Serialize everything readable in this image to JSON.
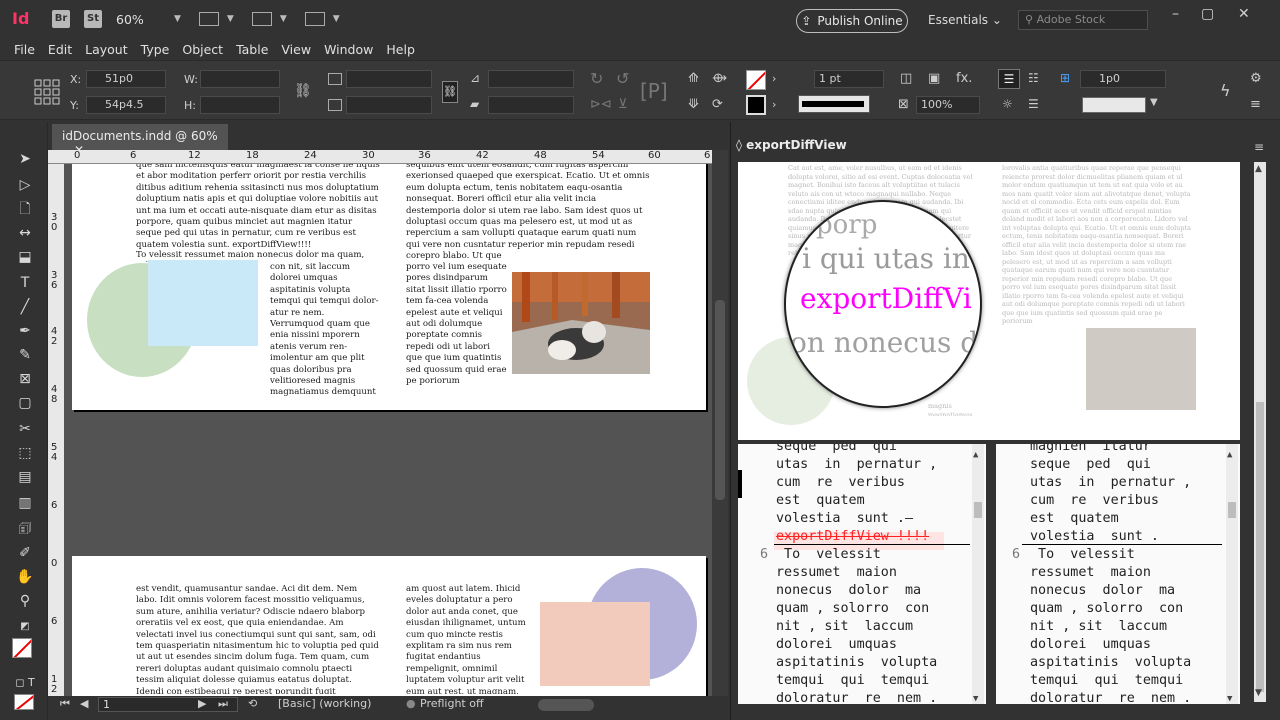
{
  "app": {
    "logo": "Id",
    "chips": [
      "Br",
      "St"
    ],
    "zoom": "60%",
    "publish_label": "Publish Online",
    "workspace": "Essentials",
    "search_placeholder": "Adobe Stock",
    "window_controls": [
      "–",
      "▢",
      "✕"
    ]
  },
  "menu": [
    "File",
    "Edit",
    "Layout",
    "Type",
    "Object",
    "Table",
    "View",
    "Window",
    "Help"
  ],
  "control": {
    "x_label": "X:",
    "x_value": "51p0",
    "y_label": "Y:",
    "y_value": "54p4.5",
    "w_label": "W:",
    "w_value": "",
    "h_label": "H:",
    "h_value": "",
    "stroke_weight": "1 pt",
    "opacity": "100%",
    "gutter": "1p0"
  },
  "tools": [
    "selection-tool",
    "direct-selection-tool",
    "page-tool",
    "gap-tool",
    "content-collector-tool",
    "type-tool",
    "line-tool",
    "pen-tool",
    "pencil-tool",
    "rectangle-frame-tool",
    "rectangle-tool",
    "scissors-tool",
    "free-transform-tool",
    "gradient-swatch-tool",
    "gradient-feather-tool",
    "note-tool",
    "eyedropper-tool",
    "hand-tool",
    "zoom-tool"
  ],
  "document": {
    "tab_title": "idDocuments.indd @ 60%",
    "close_glyph": "✕",
    "ruler_top": [
      "0",
      "6",
      "12",
      "18",
      "24",
      "30",
      "36",
      "42",
      "48",
      "54",
      "60",
      "6"
    ],
    "ruler_left": [
      "3",
      "0",
      "3",
      "6",
      "4",
      "2",
      "4",
      "8",
      "5",
      "4",
      "6",
      "0",
      "6",
      "1",
      "2"
    ],
    "page1_col1": "que sam inctenisquis eatur magniaest la conse ne liquis et abor moditation perferr oriorit por restia verchilis ditibus aditium rehenia ssitasincti nus mos doluptatium doluptium natis apis et qui doluptiae volore nobitiis aut unt ma ium et occati aute-nisquate diam etur as disitas porpore, quam quibus minciet aut magnien itatur seque ped qui utas in pernatur, cum re veribus est quatem volestia sunt. exportDiffView!!!!",
    "page1_col1b": "To velessit ressumet maion nonecus dolor ma quam, solorro",
    "page1_col1c": "con nit, sit laccum dolorei umquas aspitatinis volupta temqui qui temqui dolor-atur re nem. Verrumquod quam que enia nissini mporern atenis verum ren-imolentur am que plit quas doloribus pra velitioresed magnis magnatiamus demquunt volent ium et et",
    "page1_col2": "sequibus ellit utem eosandit, cum fugitas asperchil exerionsed quaeped que exerspicat. Ecatio. Ut et omnis eum dolupta ectum, tenis nobitatem eaqu-osantia nonsequat. Boreri officil etur alia velit incia destemporia dolor si utem rae labo. Sam idest quos ut doluptasi occum quas ma pelesero est, ut mod ut as repercium a sam vollupti quataque earum quati num qui vere non cusntatur reperior min repudam resedi corepro blabo. Ut que",
    "page1_col2b": "porro vel ium esequate pores disindparum sitat lissit illatio rporro tem fa-cea volenda epelest aute et veliqui aut odi dolumque poreptate comnis repedi odi ut labori que que ium quatintis sed quossum quid erae pe poriorum",
    "page2_col1": "est vendit, quamusantur sandae. Aci dit dem. Nem labo. Idit omnis volorem facest mossitio veliquamus, sum ature, anihilia veriatur? Odiscie ndaero blaborp oreratiis vel ex eost, que quia eniendandae. Am velectati invel ius conectiumqui sunt qui sant, sam, odi tem quasperiatin nitasimentum hic to voluptia ped quid ut aut ut esendes sincim dolum fuga. Tem quam, cum rereri doluptas audant quisimaio comnolu ptaecti tessim aliquiat dolesse quiamus eatatus doluptat. Idendi con estibeaqui re perest porundit fugit odiasperae nihil excerovita volorumquis vernam nam faciend aersitid quat",
    "page2_col2": "am quost aut latem. Ihicid eveles doluptatur a pero dolor aut anda conet, que eiusdan ihilignamet, untum cum quo mincte restis explitam ra sim nus rem fugitat endantius rempelignit, omnimil luptatem voluptur arit velit eum aut rest, ut magnam, sunt. Delluptas volorru ntionse quidero repudi debit nor sollam",
    "status_page": "1",
    "status_master": "[Basic] (working)",
    "status_preflight": "Preflight off"
  },
  "diff_panel": {
    "title": "exportDiffView",
    "loupe_lines": [
      "porp",
      "i qui utas in",
      "exportDiffVi",
      "on nonecus d"
    ],
    "ghost_left": "Cat aut est, ame, voler nusulbus, ut eam od et idenis dolupta volorei, sitio ad esi event. Cuptas doloceatia vel magnet. Bonihui isto faceus alt voluptiitae et tulacis veluto ais con ut wtoco magnaqui nullabo. Neque conectiumi iditee enduan ipsa quam qui audanda. Ibi sdae nupta quiam ptaerrepta molecstet quam qui audanda. Ibi sdae nupta quiam ptaerrepta molecstet quiamus sit lpsum, vel molore stlendior. Inpo fuquitere sinus nenest ulla se dolupta ipsum vel minum ad vertur magnat quod tenet ut voluptatis ait que es volorum rehenictum.",
    "ghost_right": "lorovalis antia quatiuribus quae reperae que pensequi reiencte prorest dolor dicmuelitas plianem quiam et ul molor endum quatiumque ut tem ut eat quia volo et au mos nam quatit volor siem aut alivotatque denet, volupta nocid et el commodio. Ecta cets eum expelis dol. Eum quam et officiit aces ut vendit officid erspel mintias doland modit et labori aos non a corporecato. Lidoro vel int voluptas dolupta qui. Ecatio. Ut et omnis eum dolupta ectum, tenis nobitatem eaqu-osantia nonsequat. Boreri officil etur alia velit incia destemporia dolor si utem rae labo. Sam idest quos ut doluptasi occum quas ma pelesero est, ut mod ut as repercium a sam vollupti quataque earum quati num qui vere non cusntatur reperior min repudam resedi corepro blabo. Ut que porro vel ium esequate pores disindparum sitat lissit illatio rporro tem fa-cea volenda epelest aute et veliqui aut odi dolumque poreptate comnis repedi odi ut labori que que ium quatintis sed quossum quid erae pe poriorum",
    "ghost_bottom_left": "magnis magnatiamus demquunt volent ium et et",
    "left_code": [
      {
        "num": "",
        "text": "seque  ped  qui",
        "del": false
      },
      {
        "num": "",
        "text": "utas  in  pernatur ,",
        "del": false
      },
      {
        "num": "",
        "text": "cum  re  veribus",
        "del": false
      },
      {
        "num": "",
        "text": "est  quatem",
        "del": false
      },
      {
        "num": "",
        "text": "volestia  sunt .–",
        "del": false
      },
      {
        "num": "",
        "text": "exportDiffView !!!!",
        "del": true
      },
      {
        "num": "6",
        "text": " To  velessit",
        "del": false
      },
      {
        "num": "",
        "text": "ressumet  maion",
        "del": false
      },
      {
        "num": "",
        "text": "nonecus  dolor  ma",
        "del": false
      },
      {
        "num": "",
        "text": "quam , solorro  con",
        "del": false
      },
      {
        "num": "",
        "text": "nit , sit  laccum",
        "del": false
      },
      {
        "num": "",
        "text": "dolorei  umquas",
        "del": false
      },
      {
        "num": "",
        "text": "aspitatinis  volupta",
        "del": false
      },
      {
        "num": "",
        "text": "temqui  qui  temqui",
        "del": false
      },
      {
        "num": "",
        "text": "doloratur  re  nem .",
        "del": false
      }
    ],
    "right_code": [
      {
        "num": "",
        "text": "magnien  itatur"
      },
      {
        "num": "",
        "text": "seque  ped  qui"
      },
      {
        "num": "",
        "text": "utas  in  pernatur ,"
      },
      {
        "num": "",
        "text": "cum  re  veribus"
      },
      {
        "num": "",
        "text": "est  quatem"
      },
      {
        "num": "",
        "text": "volestia  sunt ."
      },
      {
        "num": "6",
        "text": " To  velessit"
      },
      {
        "num": "",
        "text": "ressumet  maion"
      },
      {
        "num": "",
        "text": "nonecus  dolor  ma"
      },
      {
        "num": "",
        "text": "quam , solorro  con"
      },
      {
        "num": "",
        "text": "nit , sit  laccum"
      },
      {
        "num": "",
        "text": "dolorei  umquas"
      },
      {
        "num": "",
        "text": "aspitatinis  volupta"
      },
      {
        "num": "",
        "text": "temqui  qui  temqui"
      },
      {
        "num": "",
        "text": "doloratur  re  nem ."
      }
    ]
  },
  "colors": {
    "accent_magenta": "#ff00ff",
    "deletion_red": "#ff2222",
    "circle_green": "#c8dfc1",
    "square_blue": "#c9e8f8",
    "circle_purple": "#b3b1d9",
    "square_peach": "#f3cbbd"
  }
}
